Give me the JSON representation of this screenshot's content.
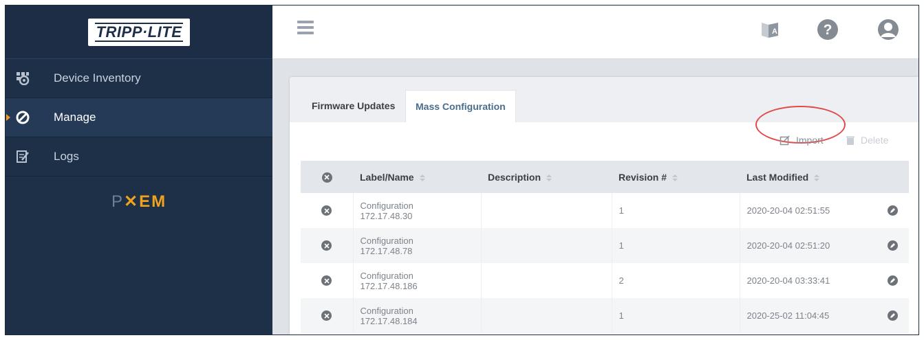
{
  "brand": {
    "logo_text": "TRIPP·LITE",
    "product_prefix": "P",
    "product_highlight": "EM",
    "product_mark": "✕"
  },
  "sidebar": {
    "items": [
      {
        "label": "Device Inventory",
        "icon": "device-inventory-icon"
      },
      {
        "label": "Manage",
        "icon": "manage-icon",
        "active": true
      },
      {
        "label": "Logs",
        "icon": "logs-icon"
      }
    ]
  },
  "header": {
    "icons": [
      "hamburger-menu-icon",
      "language-icon",
      "help-icon",
      "user-avatar-icon"
    ]
  },
  "tabs": [
    {
      "label": "Firmware Updates",
      "active": false
    },
    {
      "label": "Mass Configuration",
      "active": true
    }
  ],
  "toolbar": {
    "import_label": "Import",
    "delete_label": "Delete"
  },
  "table": {
    "headers": {
      "label": "Label/Name",
      "description": "Description",
      "revision": "Revision #",
      "modified": "Last Modified"
    },
    "rows": [
      {
        "name": "Configuration",
        "ip": "172.17.48.30",
        "description": "",
        "revision": "1",
        "modified": "2020-20-04 02:51:55"
      },
      {
        "name": "Configuration",
        "ip": "172.17.48.78",
        "description": "",
        "revision": "1",
        "modified": "2020-20-04 02:51:20"
      },
      {
        "name": "Configuration",
        "ip": "172.17.48.186",
        "description": "",
        "revision": "2",
        "modified": "2020-20-04 03:33:41"
      },
      {
        "name": "Configuration",
        "ip": "172.17.48.184",
        "description": "",
        "revision": "1",
        "modified": "2020-25-02 11:04:45"
      }
    ]
  },
  "colors": {
    "sidebar_bg": "#1d3048",
    "accent_orange": "#f39a1e",
    "tab_active_text": "#4a6d8c",
    "highlight_ring": "#e24a4a"
  }
}
